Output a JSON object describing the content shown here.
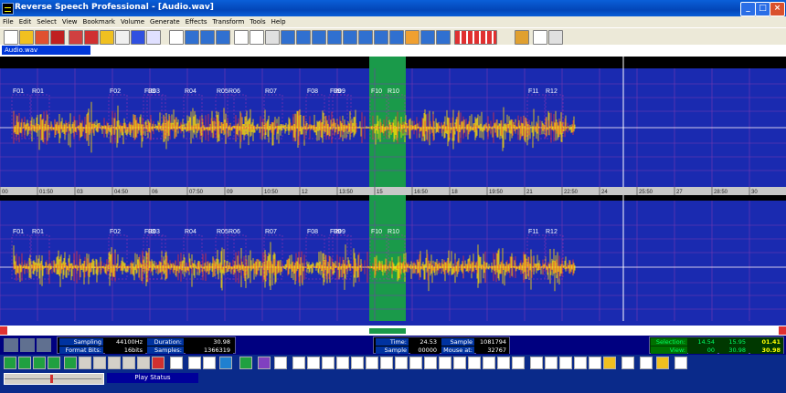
{
  "window": {
    "title": "Reverse Speech Professional - [Audio.wav]"
  },
  "menu": [
    "File",
    "Edit",
    "Select",
    "View",
    "Bookmark",
    "Volume",
    "Generate",
    "Effects",
    "Transform",
    "Tools",
    "Help"
  ],
  "tab": {
    "label": "Audio.wav"
  },
  "ruler_ticks": [
    "00",
    "01:50",
    "03",
    "04:50",
    "06",
    "07:50",
    "09",
    "10:50",
    "12",
    "13:50",
    "15",
    "16:50",
    "18",
    "19:50",
    "21",
    "22:50",
    "24",
    "25:50",
    "27",
    "28:50",
    "30"
  ],
  "markers": [
    "F01",
    "R01",
    "F02",
    "F03",
    "R03",
    "R04",
    "R05",
    "R06",
    "R07",
    "F08",
    "F09",
    "R09",
    "F10",
    "R10",
    "F11",
    "R12"
  ],
  "status": {
    "sampling_rate_label": "Sampling Rate:",
    "sampling_rate": "44100Hz",
    "duration_label": "Duration:",
    "duration": "30.98",
    "format_bits_label": "Format Bits:",
    "format_bits": "16bits",
    "samples_label": "Samples:",
    "samples": "1366319",
    "time_label": "Time:",
    "time": "24.53",
    "sample_no_label": "Sample no.:",
    "sample_no": "1081794",
    "sample_ht_label": "Sample ht.:",
    "sample_ht": "00000",
    "mouse_at_label": "Mouse at:",
    "mouse_at": "32767",
    "selection_label": "Selection:",
    "selection_start": "14.54",
    "selection_end": "15.95",
    "selection_len": "01.41",
    "view_label": "View:",
    "view_start": "00",
    "view_end": "30.98",
    "view_len": "30.98"
  },
  "play_status": "Play Status",
  "colors": {
    "wave_bg": "#1a2ab0",
    "selection": "#1a9a4a",
    "title": "#0a5fd8"
  }
}
